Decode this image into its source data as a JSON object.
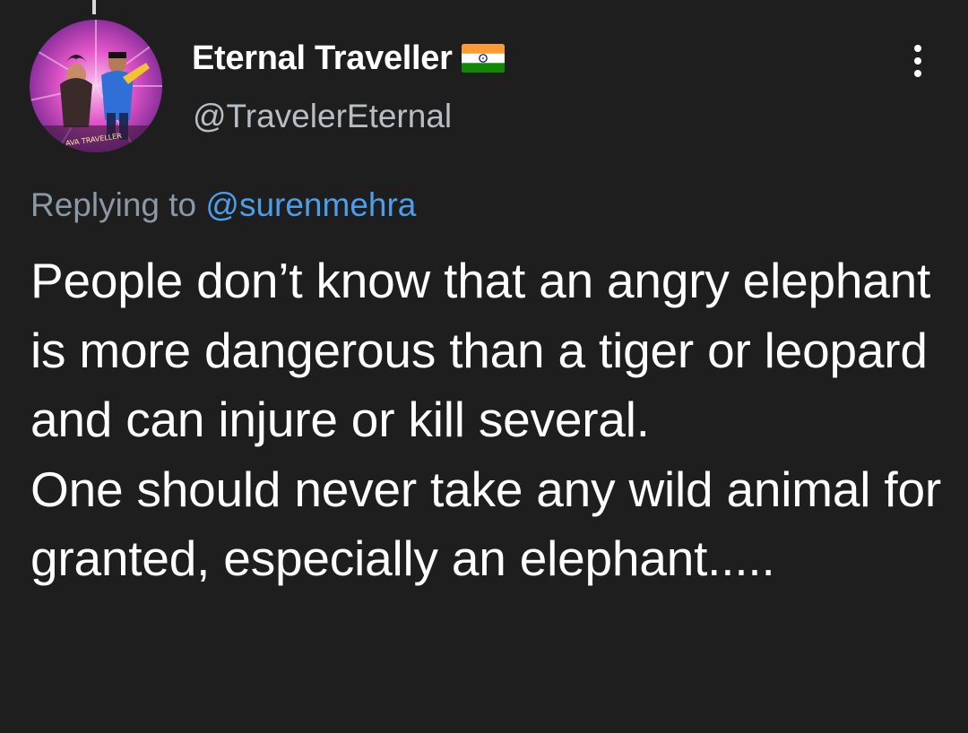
{
  "author": {
    "display_name": "Eternal Traveller",
    "flag_icon": "india-flag-icon",
    "handle": "@TravelerEternal",
    "avatar_caption": "AVA TRAVELLER"
  },
  "menu": {
    "icon": "more-vertical-icon"
  },
  "reply": {
    "prefix": "Replying to",
    "mention": "@surenmehra"
  },
  "tweet": {
    "text": "People don’t know that an angry elephant is more dangerous than a tiger or leopard and can injure or kill several.\nOne should never take any wild animal for granted, especially an elephant....."
  },
  "colors": {
    "background": "#1e1e1e",
    "text_primary": "#ffffff",
    "text_secondary": "#8b98a5",
    "link": "#4d9eea"
  }
}
